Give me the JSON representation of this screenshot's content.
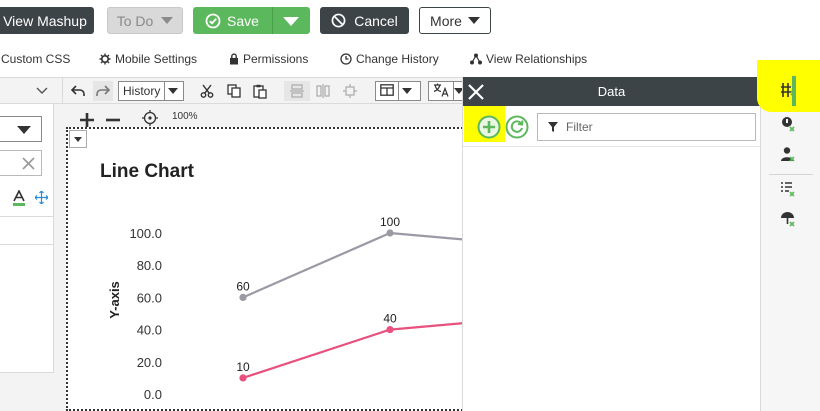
{
  "actions": {
    "view_mashup": "View Mashup",
    "todo": "To Do",
    "save": "Save",
    "cancel": "Cancel",
    "more": "More"
  },
  "links": {
    "custom_css": "Custom CSS",
    "mobile_settings": "Mobile Settings",
    "permissions": "Permissions",
    "change_history": "Change History",
    "view_relationships": "View Relationships"
  },
  "toolbar": {
    "history_select": "History",
    "zoom": "100%"
  },
  "data_panel": {
    "title": "Data",
    "filter_placeholder": "Filter"
  },
  "colors": {
    "accent_green": "#5cb85c",
    "dark": "#3c4447",
    "highlight": "#ffff00",
    "series_gray": "#999aa4",
    "series_pink": "#e8517e"
  },
  "chart_data": {
    "type": "line",
    "title": "Line Chart",
    "ylabel": "Y-axis",
    "xlabel": "",
    "ylim": [
      0,
      100
    ],
    "y_ticks": [
      "100.0",
      "80.0",
      "60.0",
      "40.0",
      "20.0",
      "0.0"
    ],
    "series": [
      {
        "color": "#999aa4",
        "values": [
          60,
          100,
          92
        ]
      },
      {
        "color": "#e8517e",
        "values": [
          10,
          40,
          48
        ]
      }
    ],
    "data_labels": [
      {
        "series": 0,
        "index": 0,
        "text": "60"
      },
      {
        "series": 0,
        "index": 1,
        "text": "100"
      },
      {
        "series": 1,
        "index": 0,
        "text": "10"
      },
      {
        "series": 1,
        "index": 1,
        "text": "40"
      }
    ]
  }
}
